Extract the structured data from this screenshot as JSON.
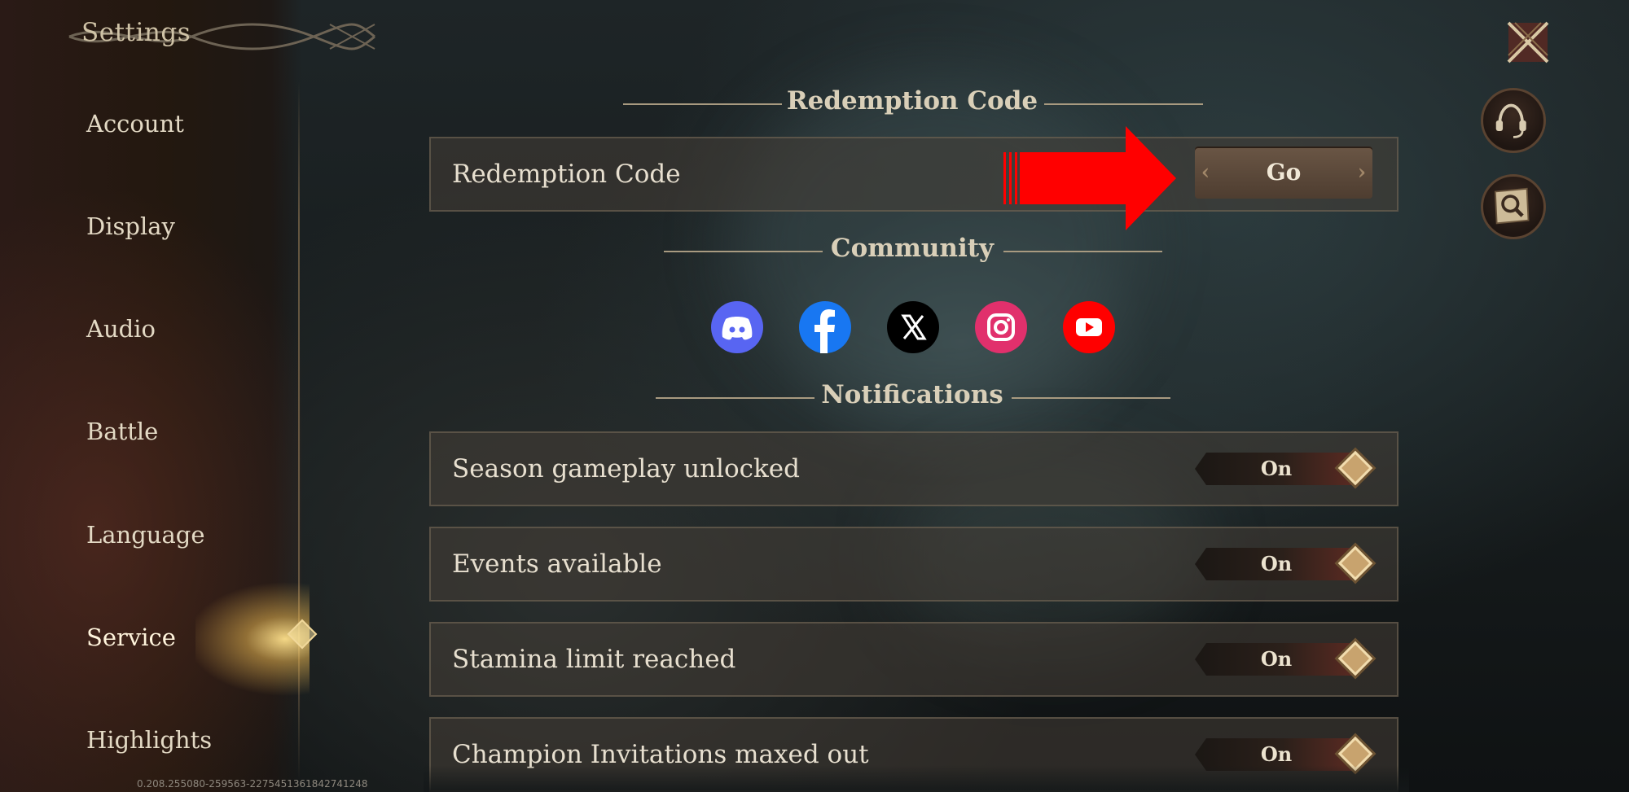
{
  "sidebar": {
    "title": "Settings",
    "items": [
      {
        "label": "Account"
      },
      {
        "label": "Display"
      },
      {
        "label": "Audio"
      },
      {
        "label": "Battle"
      },
      {
        "label": "Language"
      },
      {
        "label": "Service",
        "active": true
      },
      {
        "label": "Highlights"
      }
    ],
    "version": "0.208.255080-259563-2275451361842741248"
  },
  "sections": {
    "redemption": {
      "header": "Redemption Code",
      "row_label": "Redemption Code",
      "button_label": "Go"
    },
    "community": {
      "header": "Community",
      "icons": [
        "discord-icon",
        "facebook-icon",
        "x-icon",
        "instagram-icon",
        "youtube-icon"
      ]
    },
    "notifications": {
      "header": "Notifications",
      "rows": [
        {
          "label": "Season gameplay unlocked",
          "value": "On"
        },
        {
          "label": "Events available",
          "value": "On"
        },
        {
          "label": "Stamina limit reached",
          "value": "On"
        },
        {
          "label": "Champion Invitations maxed out",
          "value": "On"
        }
      ]
    }
  },
  "colors": {
    "discord": "#5865F2",
    "facebook": "#1877F2",
    "x": "#000000",
    "instagram": "#E1306C",
    "youtube": "#FF0000",
    "annotation_arrow": "#FF0000"
  }
}
